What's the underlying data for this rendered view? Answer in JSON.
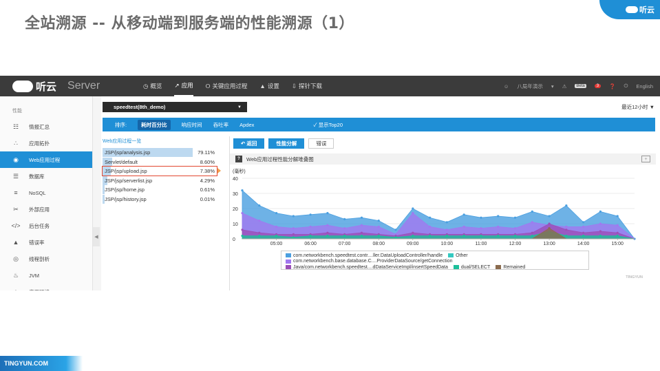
{
  "slide": {
    "title": "全站溯源 -- 从移动端到服务端的性能溯源（1）",
    "corner_logo": "听云",
    "footer": "TINGYUN.COM"
  },
  "topnav": {
    "brand": "听云",
    "product": "Server",
    "items": [
      {
        "icon": "dashboard-icon",
        "label": "概览",
        "active": false
      },
      {
        "icon": "chart-icon",
        "label": "应用",
        "active": true
      },
      {
        "icon": "key-icon",
        "label": "关键应用过程",
        "active": false
      },
      {
        "icon": "bell-icon",
        "label": "设置",
        "active": false
      },
      {
        "icon": "download-icon",
        "label": "探针下载",
        "active": false
      }
    ],
    "user": "八局年演示",
    "beta": "Beta",
    "notif_count": "3",
    "language": "English"
  },
  "sidebar": {
    "heading": "性能",
    "items": [
      {
        "icon": "grid-icon",
        "label": "情报汇总",
        "active": false
      },
      {
        "icon": "topology-icon",
        "label": "应用拓扑",
        "active": false
      },
      {
        "icon": "signal-icon",
        "label": "Web应用过程",
        "active": true
      },
      {
        "icon": "database-icon",
        "label": "数据库",
        "active": false
      },
      {
        "icon": "list-icon",
        "label": "NoSQL",
        "active": false
      },
      {
        "icon": "link-icon",
        "label": "外部应用",
        "active": false
      },
      {
        "icon": "code-icon",
        "label": "后台任务",
        "active": false
      },
      {
        "icon": "warning-icon",
        "label": "错误率",
        "active": false
      },
      {
        "icon": "thread-icon",
        "label": "线程剖析",
        "active": false
      },
      {
        "icon": "jvm-icon",
        "label": "JVM",
        "active": false
      },
      {
        "icon": "env-icon",
        "label": "应用环境",
        "active": false
      }
    ]
  },
  "main": {
    "app_name": "speedtest(8th_demo)",
    "time_range": "最近12小时",
    "sort_label": "排序:",
    "sort_options": [
      {
        "label": "耗时百分比",
        "active": true
      },
      {
        "label": "响应时间",
        "active": false
      },
      {
        "label": "吞吐率",
        "active": false
      },
      {
        "label": "Apdex",
        "active": false
      }
    ],
    "top20": "显示Top20",
    "list_title": "Web应用过程一览",
    "transactions": [
      {
        "name": "JSP/jsp/analysis.jsp",
        "pct": "79.11%",
        "fill": 0.7911,
        "selected": false
      },
      {
        "name": "Servlet/default",
        "pct": "8.60%",
        "fill": 0.086,
        "selected": false
      },
      {
        "name": "JSP/jsp/upload.jsp",
        "pct": "7.38%",
        "fill": 0.0738,
        "selected": true
      },
      {
        "name": "JSP/jsp/serverlist.jsp",
        "pct": "4.29%",
        "fill": 0.0429,
        "selected": false
      },
      {
        "name": "JSP/jsp/home.jsp",
        "pct": "0.61%",
        "fill": 0.0061,
        "selected": false
      },
      {
        "name": "JSP/jsp/history.jsp",
        "pct": "0.01%",
        "fill": 0.0001,
        "selected": false
      }
    ],
    "buttons": {
      "back": "返回",
      "breakdown": "性能分解",
      "errors": "错误"
    },
    "chart_title": "Web应用过程性能分解堆叠图",
    "expand": "+"
  },
  "chart_data": {
    "type": "area",
    "title": "Web应用过程性能分解堆叠图",
    "ylabel": "(毫秒)",
    "ylim": [
      0,
      40
    ],
    "yticks": [
      0,
      10,
      20,
      30,
      40
    ],
    "x_tick_labels": [
      "05:00",
      "06:00",
      "07:00",
      "08:00",
      "09:00",
      "10:00",
      "11:00",
      "12:00",
      "13:00",
      "14:00",
      "15:00"
    ],
    "x_hours": [
      4.0,
      4.5,
      5.0,
      5.5,
      6.0,
      6.5,
      7.0,
      7.5,
      8.0,
      8.5,
      9.0,
      9.5,
      10.0,
      10.5,
      11.0,
      11.5,
      12.0,
      12.5,
      13.0,
      13.5,
      14.0,
      14.5,
      15.0,
      15.5
    ],
    "series": [
      {
        "name": "com.networkbench.speedtest.contr....ller.DataUploadController/handle",
        "color": "#4a9fe0",
        "values": [
          32,
          22,
          17,
          15,
          16,
          17,
          13,
          14,
          12,
          6,
          20,
          14,
          11,
          16,
          14,
          15,
          14,
          18,
          15,
          22,
          11,
          18,
          15,
          0
        ]
      },
      {
        "name": "Other",
        "color": "#34c9c0",
        "values": [
          0,
          0,
          0,
          0,
          0,
          0,
          0,
          0,
          0,
          0,
          0,
          0,
          0,
          0,
          0,
          0,
          0,
          0,
          0,
          0,
          0,
          0,
          0,
          0
        ]
      },
      {
        "name": "com.networkbench.base.database.C....ProviderDataSource/getConnection",
        "color": "#a178f0",
        "values": [
          17,
          12,
          8,
          7,
          8,
          9,
          7,
          9,
          8,
          3,
          17,
          8,
          6,
          8,
          7,
          8,
          7,
          11,
          9,
          8,
          8,
          10,
          9,
          0
        ]
      },
      {
        "name": "Java/com.networkbench.speedtest....dDataServiceImpl/insertSpeedData",
        "color": "#9b4fb8",
        "values": [
          6,
          4,
          3,
          3,
          3,
          4,
          3,
          4,
          3,
          2,
          4,
          3,
          3,
          3,
          3,
          3,
          3,
          4,
          10,
          6,
          4,
          5,
          4,
          0
        ]
      },
      {
        "name": "dual/SELECT",
        "color": "#1dbf9a",
        "values": [
          2,
          2,
          2,
          1,
          2,
          2,
          2,
          2,
          2,
          1,
          2,
          2,
          2,
          2,
          2,
          2,
          2,
          2,
          5,
          2,
          2,
          2,
          2,
          0
        ]
      },
      {
        "name": "Remained",
        "color": "#8b6b4e",
        "values": [
          0,
          0,
          0,
          0,
          0,
          0,
          0,
          0,
          0,
          0,
          0,
          0,
          0,
          0,
          0,
          0,
          0,
          0,
          7,
          0,
          0,
          0,
          0,
          0
        ]
      }
    ],
    "grid": true,
    "legend_position": "bottom"
  },
  "watermark": "TINGYUN"
}
